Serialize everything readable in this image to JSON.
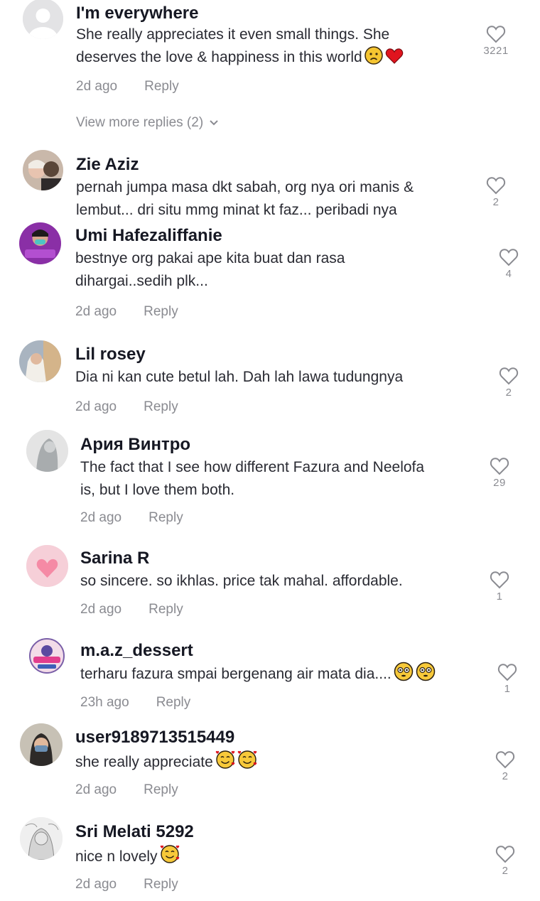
{
  "comments": [
    {
      "user": "I'm everywhere",
      "line1": "She really appreciates it even small things. She",
      "line2": "deserves the love & happiness in this world",
      "emojis_line2": [
        "crying-face",
        "red-heart"
      ],
      "time": "2d ago",
      "reply": "Reply",
      "likes": "3221"
    },
    {
      "user": "Zie Aziz",
      "line1": "pernah jumpa masa dkt sabah, org nya ori manis &",
      "line2": "lembut... dri situ mmg minat kt faz... peribadi nya",
      "likes": "2"
    },
    {
      "user": "Umi Hafezaliffanie",
      "line1": "bestnye org pakai ape kita buat dan rasa",
      "line2": "dihargai..sedih plk...",
      "time": "2d ago",
      "reply": "Reply",
      "likes": "4"
    },
    {
      "user": "Lil rosey",
      "line1": "Dia ni kan cute betul lah. Dah lah lawa tudungnya",
      "time": "2d ago",
      "reply": "Reply",
      "likes": "2"
    },
    {
      "user": "Ария Винтро",
      "line1": "The fact that I see how different Fazura and Neelofa",
      "line2": "is, but I love them both.",
      "time": "2d ago",
      "reply": "Reply",
      "likes": "29"
    },
    {
      "user": "Sarina R",
      "line1": "so sincere. so ikhlas. price tak mahal. affordable.",
      "time": "2d ago",
      "reply": "Reply",
      "likes": "1"
    },
    {
      "user": "m.a.z_dessert",
      "line1": "terharu fazura smpai bergenang air mata dia....",
      "emojis_line1": [
        "flushed-face",
        "flushed-face"
      ],
      "time": "23h ago",
      "reply": "Reply",
      "likes": "1"
    },
    {
      "user": "user9189713515449",
      "line1": "she really appreciate",
      "emojis_line1": [
        "smiling-face-with-hearts",
        "smiling-face-with-hearts"
      ],
      "time": "2d ago",
      "reply": "Reply",
      "likes": "2"
    },
    {
      "user": "Sri Melati 5292",
      "line1": "nice n lovely",
      "emojis_line1": [
        "smiling-face-with-hearts"
      ],
      "time": "2d ago",
      "reply": "Reply",
      "likes": "2"
    }
  ],
  "view_more_replies": "View more replies (2)",
  "colors": {
    "text": "#161823",
    "secondary": "#8a8b91",
    "heart_outline": "#8a8b91"
  }
}
